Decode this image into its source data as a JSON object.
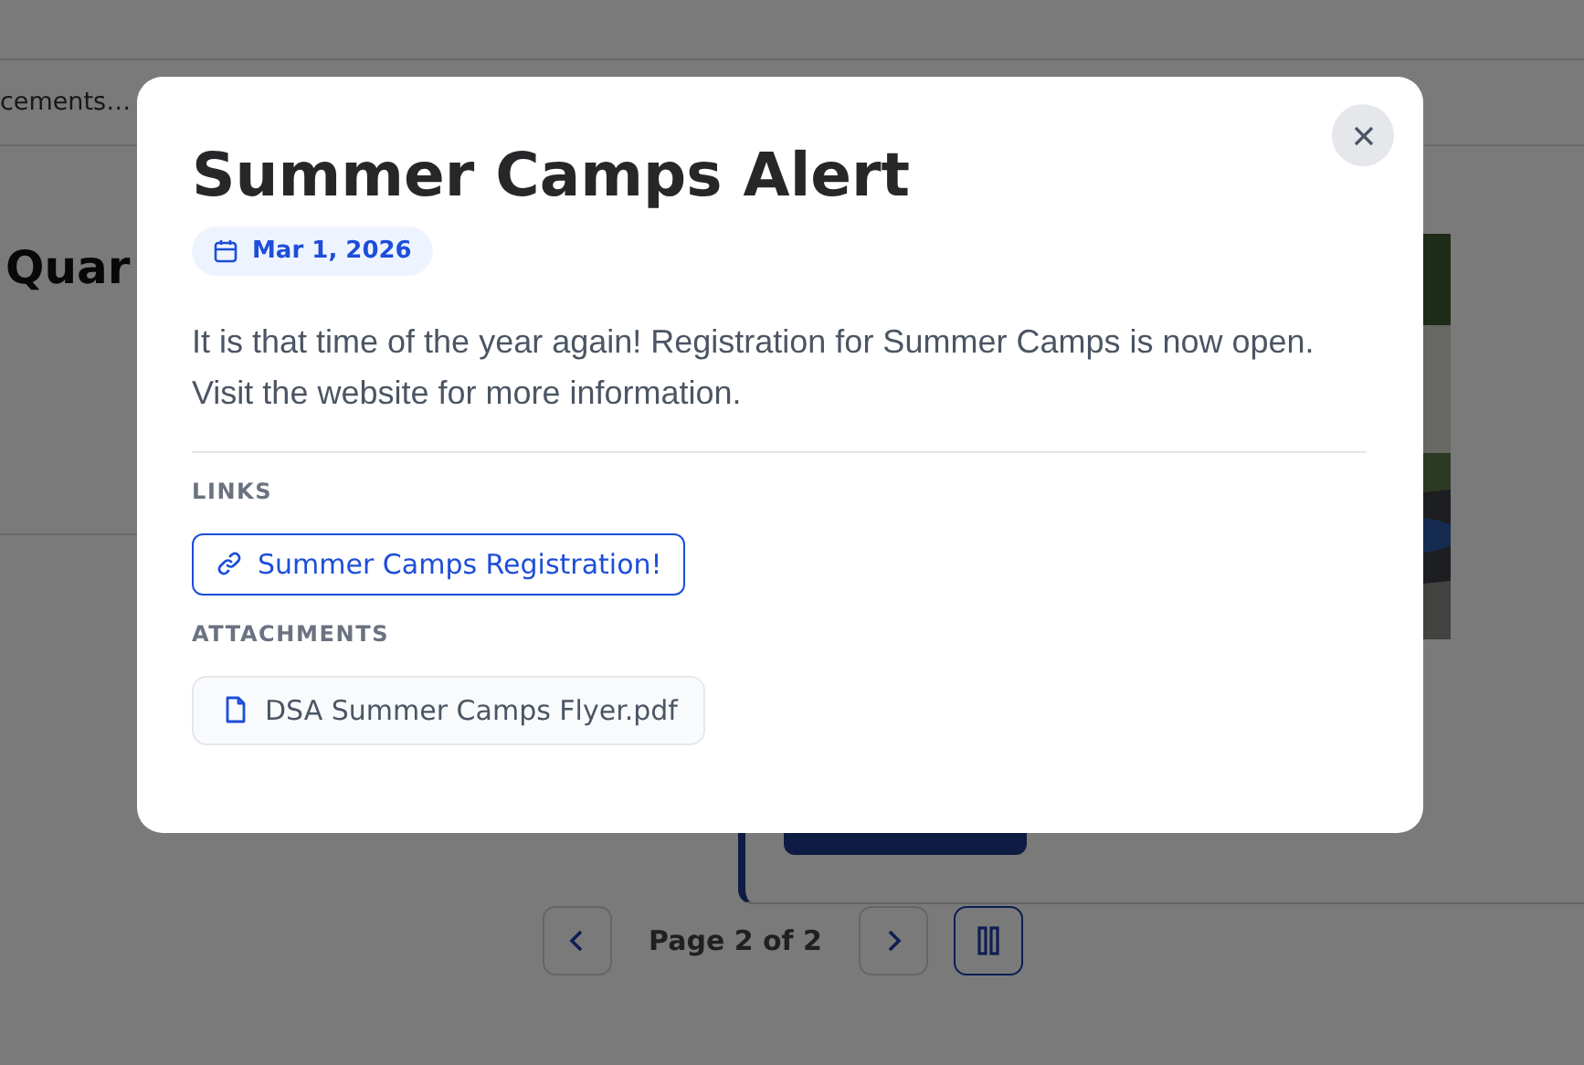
{
  "page": {
    "breadcrumb": "cements…",
    "heading": "Quar"
  },
  "modal": {
    "title": "Summer Camps Alert",
    "date": "Mar 1, 2026",
    "body": "It is that time of the year again! Registration for Summer Camps is now open. Visit the website for more information.",
    "links_label": "LINKS",
    "links": [
      {
        "label": "Summer Camps Registration!"
      }
    ],
    "attachments_label": "ATTACHMENTS",
    "attachments": [
      {
        "name": "DSA Summer Camps Flyer.pdf"
      }
    ]
  },
  "pagination": {
    "label": "Page 2 of 2"
  }
}
